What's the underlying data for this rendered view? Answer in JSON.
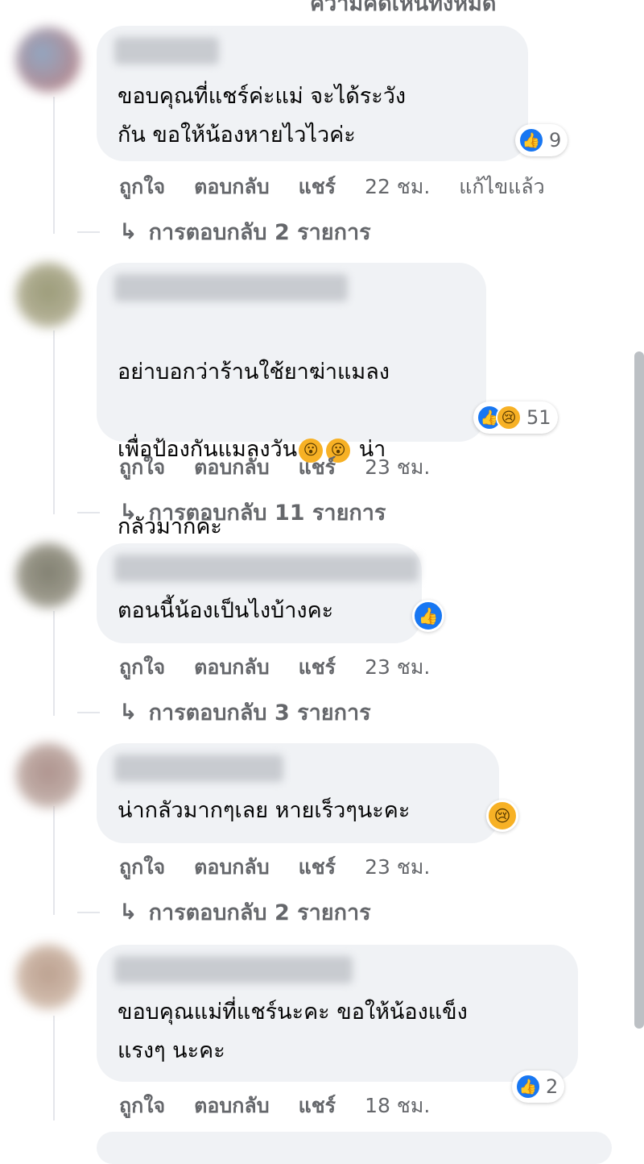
{
  "top_partial_text": "ความคิดเห็นทั้งหมด",
  "action_labels": {
    "like": "ถูกใจ",
    "reply": "ตอบกลับ",
    "share": "แชร์"
  },
  "comments": [
    {
      "text_lines": "ขอบคุณที่แชร์ค่ะแม่ จะได้ระวัง\nกัน ขอให้น้องหายไวไวค่ะ",
      "reaction_count": "9",
      "time": "22 ชม.",
      "edited": "แก้ไขแล้ว",
      "replies": "การตอบกลับ 2 รายการ"
    },
    {
      "text_line1": "อย่าบอกว่าร้านใช้ยาฆ่าแมลง",
      "text_line2a": "เพื่อป้องกันแมลงวัน",
      "text_line2b": " น่า",
      "text_line3": "กลัวมากค่ะ",
      "reaction_count": "51",
      "time": "23 ชม.",
      "replies": "การตอบกลับ 11 รายการ"
    },
    {
      "text": "ตอนนี้น้องเป็นไงบ้างคะ",
      "time": "23 ชม.",
      "replies": "การตอบกลับ 3 รายการ"
    },
    {
      "text": "น่ากลัวมากๆเลย หายเร็วๆนะคะ",
      "time": "23 ชม.",
      "replies": "การตอบกลับ 2 รายการ"
    },
    {
      "text_lines": "ขอบคุณแม่ที่แชร์นะคะ ขอให้น้องแข็ง\nแรงๆ นะคะ",
      "reaction_count": "2",
      "time": "18 ชม."
    }
  ],
  "icons": {
    "like": "like-icon",
    "sad": "sad-icon",
    "wow": "wow-icon",
    "reply_arrow": "reply-arrow-icon"
  },
  "colors": {
    "like_blue": "#1877f2",
    "bubble": "#f0f2f5",
    "meta_text": "#65676b",
    "sad_yellow": "#f7b125"
  }
}
